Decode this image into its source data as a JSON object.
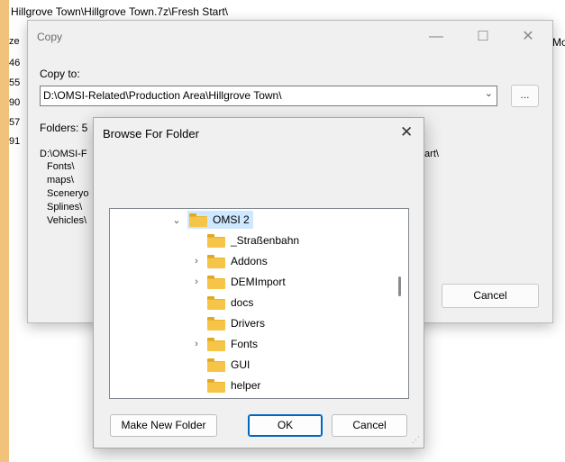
{
  "background": {
    "path": "Hillgrove Town\\Hillgrove Town.7z\\Fresh Start\\",
    "column_size_fragment": "ze",
    "column_mo_fragment": "Mo",
    "size_fragments": [
      "46",
      "55",
      "90",
      "57",
      "91"
    ]
  },
  "copy_dialog": {
    "title": "Copy",
    "minimize": "—",
    "maximize": "☐",
    "close": "✕",
    "copy_to_label": "Copy to:",
    "copy_to_value": "D:\\OMSI-Related\\Production Area\\Hillgrove Town\\",
    "browse_button": "...",
    "folders_label": "Folders: 5",
    "list_path": "D:\\OMSI-F",
    "list_path_tail": "tart\\",
    "list_items": [
      "Fonts\\",
      "maps\\",
      "Sceneryo",
      "Splines\\",
      "Vehicles\\"
    ],
    "cancel": "Cancel"
  },
  "browse_dialog": {
    "title": "Browse For Folder",
    "close": "✕",
    "tree": [
      {
        "label": "OMSI 2",
        "expanded": true,
        "selected": true
      },
      {
        "label": "_Straßenbahn",
        "has_children": false
      },
      {
        "label": "Addons",
        "has_children": true
      },
      {
        "label": "DEMImport",
        "has_children": true
      },
      {
        "label": "docs",
        "has_children": false
      },
      {
        "label": "Drivers",
        "has_children": false
      },
      {
        "label": "Fonts",
        "has_children": true
      },
      {
        "label": "GUI",
        "has_children": false
      },
      {
        "label": "helper",
        "has_children": false
      }
    ],
    "make_new_folder": "Make New Folder",
    "ok": "OK",
    "cancel": "Cancel"
  },
  "icons": {
    "folder": "folder-icon",
    "expand": "chevron-right-icon",
    "collapse": "chevron-down-icon"
  },
  "colors": {
    "folder": "#f6c548",
    "selection": "#cde8ff",
    "default_button_border": "#0067c0"
  }
}
